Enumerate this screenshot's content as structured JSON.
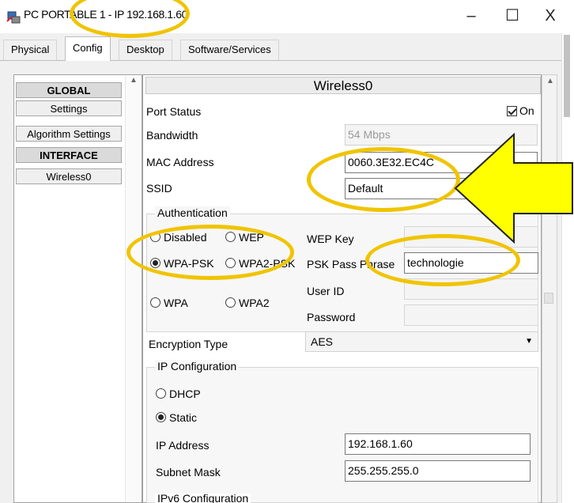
{
  "window": {
    "title": "PC PORTABLE 1 - IP 192.168.1.60",
    "minimize": "–",
    "maximize": "☐",
    "close": "X"
  },
  "tabs": [
    {
      "label": "Physical",
      "active": false
    },
    {
      "label": "Config",
      "active": true
    },
    {
      "label": "Desktop",
      "active": false
    },
    {
      "label": "Software/Services",
      "active": false
    }
  ],
  "sidebar": {
    "items": [
      {
        "label": "GLOBAL",
        "type": "header"
      },
      {
        "label": "Settings",
        "type": "item"
      },
      {
        "label": "Algorithm Settings",
        "type": "item"
      },
      {
        "label": "INTERFACE",
        "type": "header"
      },
      {
        "label": "Wireless0",
        "type": "item"
      }
    ]
  },
  "panel": {
    "title": "Wireless0",
    "port_status_label": "Port Status",
    "port_status_checkbox": "On",
    "port_status_checked": true,
    "bandwidth_label": "Bandwidth",
    "bandwidth_value": "54 Mbps",
    "mac_label": "MAC Address",
    "mac_value": "0060.3E32.EC4C",
    "ssid_label": "SSID",
    "ssid_value": "Default",
    "authentication": {
      "title": "Authentication",
      "options": {
        "disabled": "Disabled",
        "wep": "WEP",
        "wpa_psk": "WPA-PSK",
        "wpa2_psk": "WPA2-PSK",
        "wpa": "WPA",
        "wpa2": "WPA2"
      },
      "selected": "WPA-PSK",
      "wep_key_label": "WEP Key",
      "psk_label": "PSK Pass Phrase",
      "psk_value": "technologie",
      "user_id_label": "User ID",
      "password_label": "Password"
    },
    "encryption_label": "Encryption Type",
    "encryption_value": "AES",
    "ip_config": {
      "title": "IP Configuration",
      "dhcp_label": "DHCP",
      "static_label": "Static",
      "selected": "Static",
      "ip_label": "IP Address",
      "ip_value": "192.168.1.60",
      "mask_label": "Subnet Mask",
      "mask_value": "255.255.255.0"
    },
    "ipv6_title": "IPv6 Configuration"
  },
  "colors": {
    "highlight_yellow": "#f0c400",
    "arrow_fill": "#ffff00"
  }
}
